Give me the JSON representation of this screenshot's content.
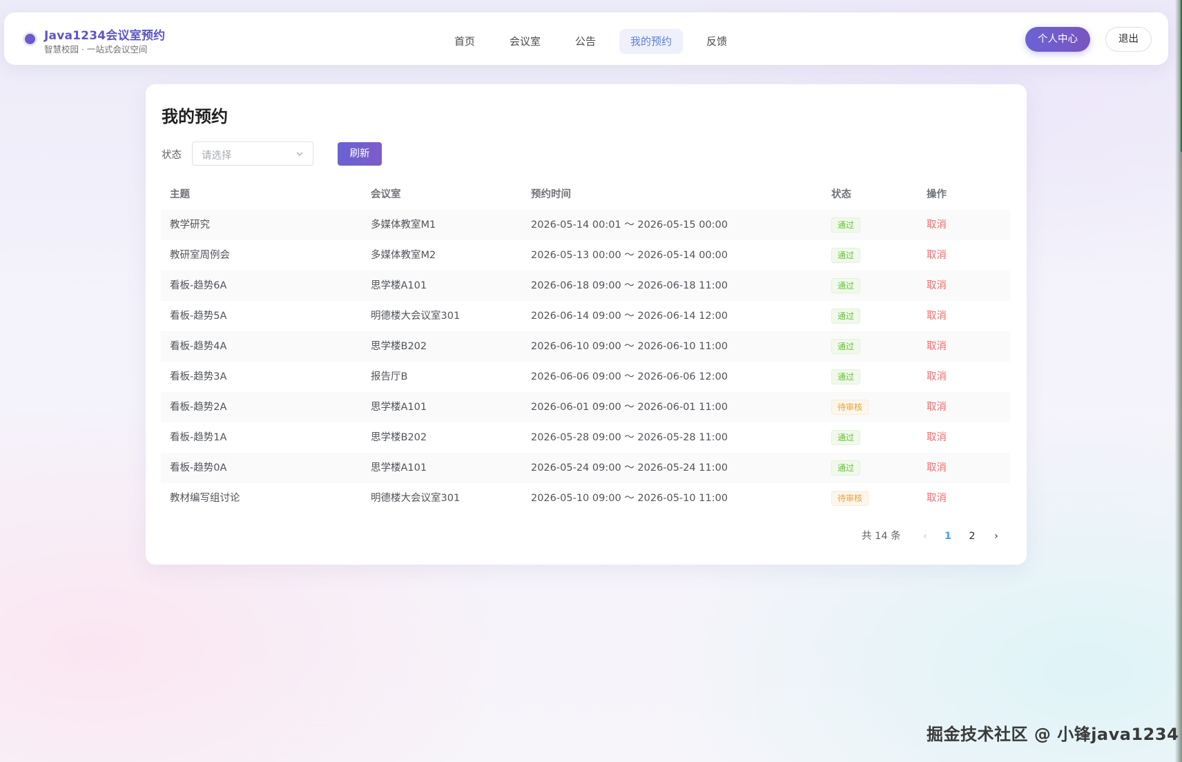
{
  "header": {
    "brand_title": "Java1234会议室预约",
    "brand_sub": "智慧校园 · 一站式会议空间",
    "nav": [
      "首页",
      "会议室",
      "公告",
      "我的预约",
      "反馈"
    ],
    "active_nav": "我的预约",
    "btn_center": "个人中心",
    "btn_logout": "退出"
  },
  "page": {
    "title": "我的预约",
    "filter_label": "状态",
    "select_placeholder": "请选择",
    "refresh_label": "刷新"
  },
  "table": {
    "columns": [
      "主题",
      "会议室",
      "预约时间",
      "状态",
      "操作"
    ],
    "rows": [
      {
        "topic": "教学研究",
        "room": "多媒体教室M1",
        "time": "2026-05-14 00:01 ～ 2026-05-15 00:00",
        "status": "通过",
        "status_type": "ok",
        "action": "取消"
      },
      {
        "topic": "教研室周例会",
        "room": "多媒体教室M2",
        "time": "2026-05-13 00:00 ～ 2026-05-14 00:00",
        "status": "通过",
        "status_type": "ok",
        "action": "取消"
      },
      {
        "topic": "看板-趋势6A",
        "room": "思学楼A101",
        "time": "2026-06-18 09:00 ～ 2026-06-18 11:00",
        "status": "通过",
        "status_type": "ok",
        "action": "取消"
      },
      {
        "topic": "看板-趋势5A",
        "room": "明德楼大会议室301",
        "time": "2026-06-14 09:00 ～ 2026-06-14 12:00",
        "status": "通过",
        "status_type": "ok",
        "action": "取消"
      },
      {
        "topic": "看板-趋势4A",
        "room": "思学楼B202",
        "time": "2026-06-10 09:00 ～ 2026-06-10 11:00",
        "status": "通过",
        "status_type": "ok",
        "action": "取消"
      },
      {
        "topic": "看板-趋势3A",
        "room": "报告厅B",
        "time": "2026-06-06 09:00 ～ 2026-06-06 12:00",
        "status": "通过",
        "status_type": "ok",
        "action": "取消"
      },
      {
        "topic": "看板-趋势2A",
        "room": "思学楼A101",
        "time": "2026-06-01 09:00 ～ 2026-06-01 11:00",
        "status": "待审核",
        "status_type": "pending",
        "action": "取消"
      },
      {
        "topic": "看板-趋势1A",
        "room": "思学楼B202",
        "time": "2026-05-28 09:00 ～ 2026-05-28 11:00",
        "status": "通过",
        "status_type": "ok",
        "action": "取消"
      },
      {
        "topic": "看板-趋势0A",
        "room": "思学楼A101",
        "time": "2026-05-24 09:00 ～ 2026-05-24 11:00",
        "status": "通过",
        "status_type": "ok",
        "action": "取消"
      },
      {
        "topic": "教材编写组讨论",
        "room": "明德楼大会议室301",
        "time": "2026-05-10 09:00 ～ 2026-05-10 11:00",
        "status": "待审核",
        "status_type": "pending",
        "action": "取消"
      }
    ]
  },
  "pagination": {
    "total_text": "共 14 条",
    "pages": [
      "1",
      "2"
    ],
    "current": "1",
    "prev_icon": "chevron-left-icon",
    "next_icon": "chevron-right-icon"
  },
  "colors": {
    "accent": "#6b62d6",
    "nav_active": "#5a7fd6",
    "status_ok": "#67c23a",
    "status_pending": "#e6a23c",
    "danger": "#f56c6c",
    "page_active": "#409eff"
  },
  "watermark": "掘金技术社区 @ 小锋java1234"
}
